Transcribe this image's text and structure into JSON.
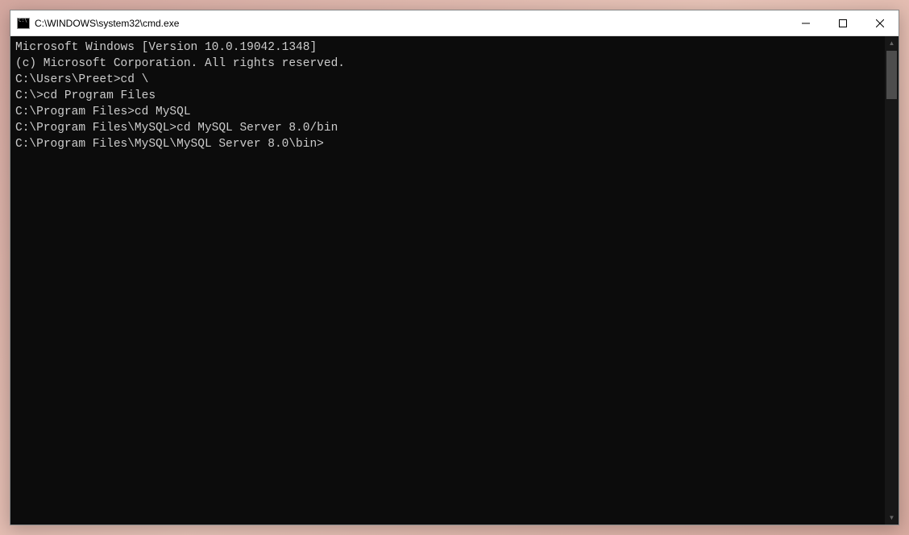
{
  "titlebar": {
    "title": "C:\\WINDOWS\\system32\\cmd.exe"
  },
  "terminal": {
    "lines": [
      "Microsoft Windows [Version 10.0.19042.1348]",
      "(c) Microsoft Corporation. All rights reserved.",
      "",
      "C:\\Users\\Preet>cd \\",
      "",
      "C:\\>cd Program Files",
      "",
      "C:\\Program Files>cd MySQL",
      "",
      "C:\\Program Files\\MySQL>cd MySQL Server 8.0/bin",
      "",
      "C:\\Program Files\\MySQL\\MySQL Server 8.0\\bin>"
    ]
  }
}
